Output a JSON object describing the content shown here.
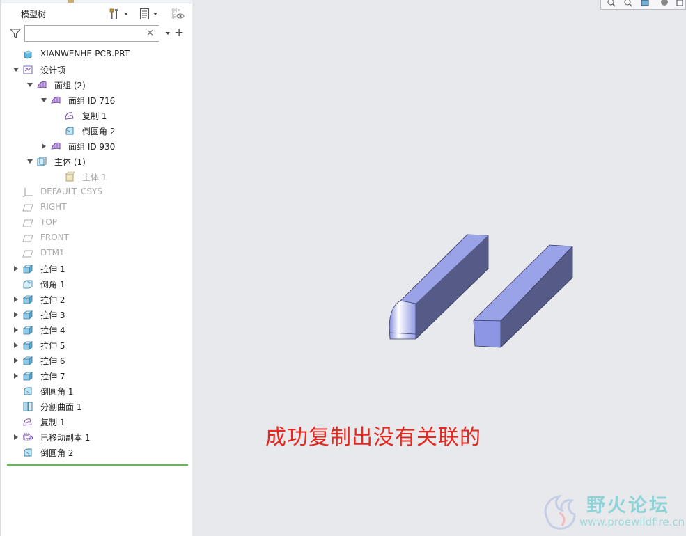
{
  "panel": {
    "title": "模型树",
    "search": {
      "value": "",
      "clear": "×",
      "add": "+"
    }
  },
  "tree": [
    {
      "label": "XIANWENHE-PCB.PRT",
      "icon": "part-icon",
      "expander": "none",
      "level": 0,
      "dim": false
    },
    {
      "label": "设计项",
      "icon": "design-items-icon",
      "expander": "down",
      "level": 0,
      "dim": false
    },
    {
      "label": "面组 (2)",
      "icon": "quilt-icon",
      "expander": "down",
      "level": 1,
      "dim": false
    },
    {
      "label": "面组 ID 716",
      "icon": "quilt-icon",
      "expander": "down",
      "level": 2,
      "dim": false
    },
    {
      "label": "复制 1",
      "icon": "copy-surface-icon",
      "expander": "none",
      "level": 3,
      "dim": false
    },
    {
      "label": "倒圆角 2",
      "icon": "round-icon",
      "expander": "none",
      "level": 3,
      "dim": false
    },
    {
      "label": "面组 ID 930",
      "icon": "quilt-icon",
      "expander": "right",
      "level": 2,
      "dim": false
    },
    {
      "label": "主体 (1)",
      "icon": "bodies-icon",
      "expander": "down",
      "level": 1,
      "dim": false
    },
    {
      "label": "主体 1",
      "icon": "body-icon",
      "expander": "none",
      "level": 3,
      "dim": true
    },
    {
      "label": "DEFAULT_CSYS",
      "icon": "csys-icon",
      "expander": "none",
      "level": 0,
      "dim": true
    },
    {
      "label": "RIGHT",
      "icon": "datum-plane-icon",
      "expander": "none",
      "level": 0,
      "dim": true
    },
    {
      "label": "TOP",
      "icon": "datum-plane-icon",
      "expander": "none",
      "level": 0,
      "dim": true
    },
    {
      "label": "FRONT",
      "icon": "datum-plane-icon",
      "expander": "none",
      "level": 0,
      "dim": true
    },
    {
      "label": "DTM1",
      "icon": "datum-plane-icon",
      "expander": "none",
      "level": 0,
      "dim": true
    },
    {
      "label": "拉伸 1",
      "icon": "extrude-icon",
      "expander": "right",
      "level": 0,
      "dim": false
    },
    {
      "label": "倒角 1",
      "icon": "chamfer-icon",
      "expander": "none",
      "level": 0,
      "dim": false
    },
    {
      "label": "拉伸 2",
      "icon": "extrude-icon",
      "expander": "right",
      "level": 0,
      "dim": false
    },
    {
      "label": "拉伸 3",
      "icon": "extrude-icon",
      "expander": "right",
      "level": 0,
      "dim": false
    },
    {
      "label": "拉伸 4",
      "icon": "extrude-icon",
      "expander": "right",
      "level": 0,
      "dim": false
    },
    {
      "label": "拉伸 5",
      "icon": "extrude-icon",
      "expander": "right",
      "level": 0,
      "dim": false
    },
    {
      "label": "拉伸 6",
      "icon": "extrude-icon",
      "expander": "right",
      "level": 0,
      "dim": false
    },
    {
      "label": "拉伸 7",
      "icon": "extrude-icon",
      "expander": "right",
      "level": 0,
      "dim": false
    },
    {
      "label": "倒圆角 1",
      "icon": "round-icon",
      "expander": "none",
      "level": 0,
      "dim": false
    },
    {
      "label": "分割曲面 1",
      "icon": "split-surface-icon",
      "expander": "none",
      "level": 0,
      "dim": false
    },
    {
      "label": "复制 1",
      "icon": "copy-surface-icon",
      "expander": "none",
      "level": 0,
      "dim": false
    },
    {
      "label": "已移动副本 1",
      "icon": "moved-copy-icon",
      "expander": "right",
      "level": 0,
      "dim": false
    },
    {
      "label": "倒圆角 2",
      "icon": "round-icon",
      "expander": "none",
      "level": 0,
      "dim": false
    }
  ],
  "graphics": {
    "annotation": "成功复制出没有关联的",
    "body_color": "#9aa3e8",
    "body_shadow": "#555b86"
  },
  "watermark": {
    "title": "野火论坛",
    "url": "www.proewildfire.cn"
  }
}
